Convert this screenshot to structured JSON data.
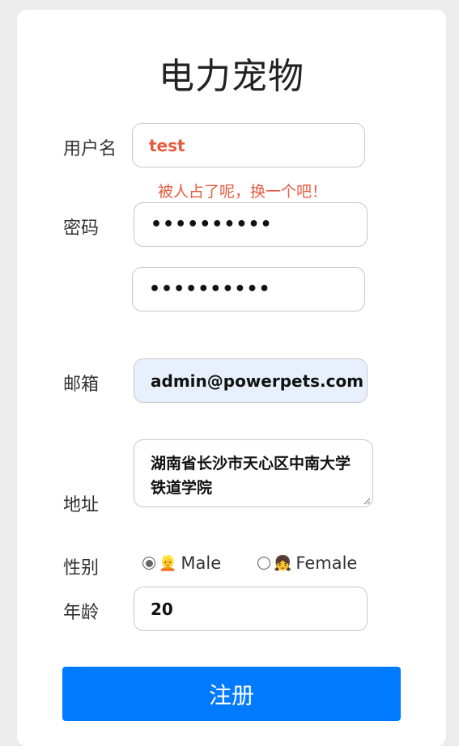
{
  "title": "电力宠物",
  "username": {
    "label": "用户名",
    "value": "test",
    "error": "被人占了呢，换一个吧！"
  },
  "password": {
    "label": "密码",
    "value": "••••••••••",
    "confirm_value": "••••••••••"
  },
  "email": {
    "label": "邮箱",
    "value": "admin@powerpets.com"
  },
  "address": {
    "label": "地址",
    "value": "湖南省长沙市天心区中南大学铁道学院"
  },
  "gender": {
    "label": "性别",
    "options": [
      {
        "emoji": "👱",
        "label": "Male",
        "checked": true
      },
      {
        "emoji": "👧",
        "label": "Female",
        "checked": false
      }
    ]
  },
  "age": {
    "label": "年龄",
    "value": "20"
  },
  "submit_label": "注册",
  "colors": {
    "accent": "#007bff",
    "error": "#e65a3e",
    "autofill_bg": "#e8f0fe"
  }
}
